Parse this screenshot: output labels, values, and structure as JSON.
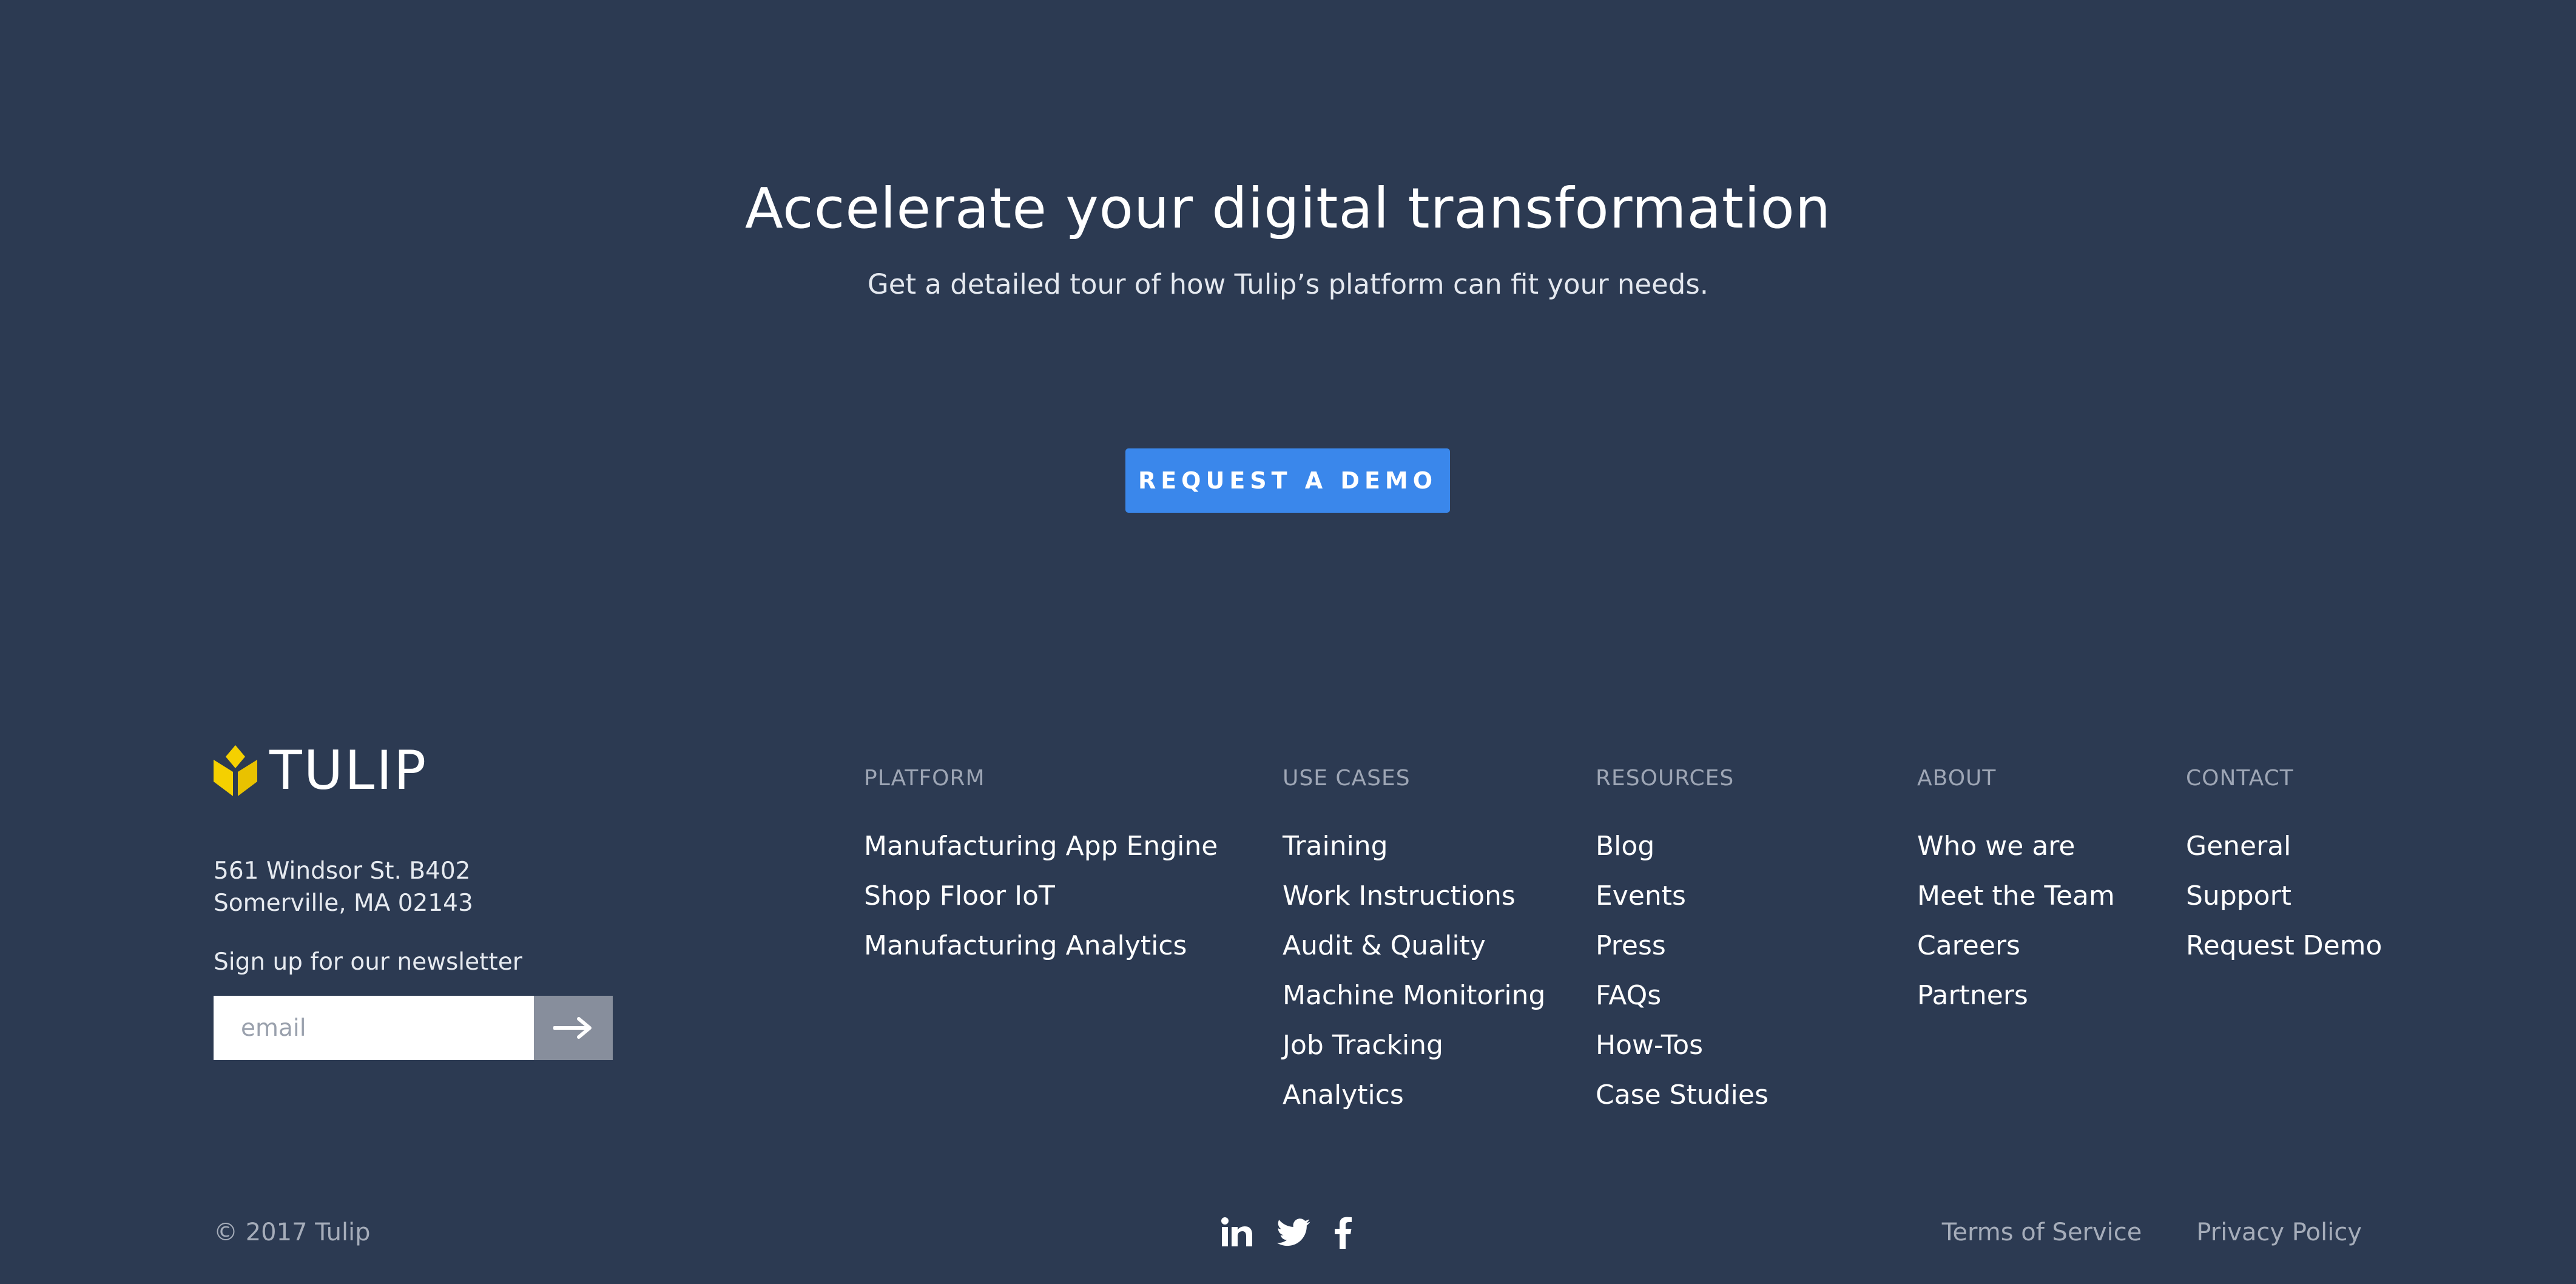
{
  "cta": {
    "title": "Accelerate your digital transformation",
    "subtitle": "Get a detailed tour of how Tulip’s platform can fit your needs.",
    "button_label": "REQUEST A DEMO"
  },
  "brand": {
    "name": "TULIP",
    "logo_color": "#f5d000",
    "address_line1": "561 Windsor St. B402",
    "address_line2": "Somerville, MA 02143"
  },
  "newsletter": {
    "label": "Sign up for our newsletter",
    "placeholder": "email",
    "value": "",
    "submit_icon": "arrow-right-icon"
  },
  "footer": {
    "columns": [
      {
        "heading": "PLATFORM",
        "items": [
          "Manufacturing App Engine",
          "Shop Floor IoT",
          "Manufacturing Analytics"
        ]
      },
      {
        "heading": "USE CASES",
        "items": [
          "Training",
          "Work Instructions",
          "Audit & Quality",
          "Machine Monitoring",
          "Job Tracking",
          "Analytics"
        ]
      },
      {
        "heading": "RESOURCES",
        "items": [
          "Blog",
          "Events",
          "Press",
          "FAQs",
          "How-Tos",
          "Case Studies"
        ]
      },
      {
        "heading": "ABOUT",
        "items": [
          "Who we are",
          "Meet the Team",
          "Careers",
          "Partners"
        ]
      },
      {
        "heading": "CONTACT",
        "items": [
          "General",
          "Support",
          "Request Demo"
        ]
      }
    ]
  },
  "bottom": {
    "copyright": "© 2017 Tulip",
    "socials": [
      "linkedin-icon",
      "twitter-icon",
      "facebook-icon"
    ],
    "terms_label": "Terms of Service",
    "privacy_label": "Privacy Policy"
  },
  "colors": {
    "background": "#2c3a52",
    "accent": "#3a87eb",
    "muted_text": "#a6adba",
    "submit_button": "#878e9c"
  }
}
